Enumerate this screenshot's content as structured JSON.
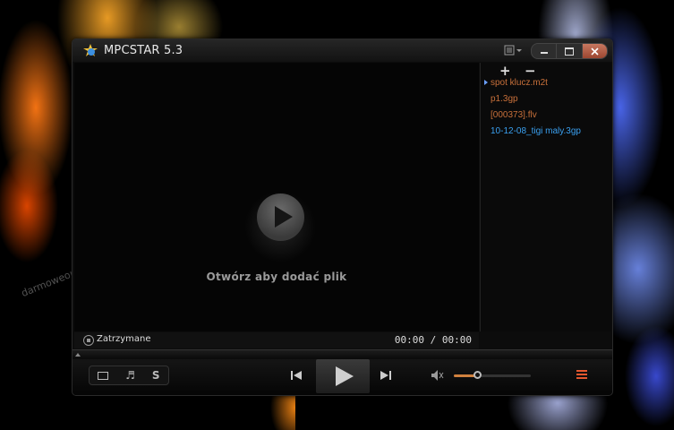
{
  "app": {
    "title": "MPCSTAR 5.3"
  },
  "watermark": "darmoweoprogramowanie.blogspot.com",
  "player": {
    "open_prompt": "Otwórz aby dodać plik",
    "status": "Zatrzymane",
    "time": "00:00 / 00:00",
    "volume_level": 0.3
  },
  "playlist": {
    "add_label": "+",
    "remove_label": "−",
    "items": [
      {
        "name": "spot klucz.m2t",
        "color": "#c8703a",
        "current": true
      },
      {
        "name": "p1.3gp",
        "color": "#c8703a",
        "current": false
      },
      {
        "name": "[000373].flv",
        "color": "#c8703a",
        "current": false
      },
      {
        "name": "10-12-08_tigi maly.3gp",
        "color": "#3aa0f0",
        "current": false
      }
    ]
  },
  "controls": {
    "music_glyph": "♬",
    "s_label": "S"
  },
  "icons": {
    "app": "mpcstar-logo-icon",
    "menu": "menu-list-icon",
    "prev": "previous-track-icon",
    "next": "next-track-icon",
    "volume": "speaker-icon",
    "playlist": "playlist-toggle-icon"
  }
}
